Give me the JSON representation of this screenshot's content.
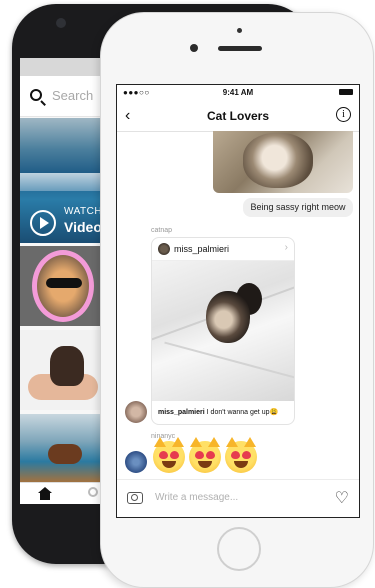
{
  "back_phone": {
    "search_placeholder": "Search",
    "video_tile": {
      "watch_label": "WATCH",
      "video_label": "Video"
    },
    "tabbar": {
      "home_icon": "home-icon",
      "search_icon": "search-icon"
    }
  },
  "front_phone": {
    "status_bar": {
      "signal": "●●●○○",
      "time": "9:41 AM"
    },
    "nav": {
      "back_glyph": "‹",
      "title": "Cat Lovers",
      "info_glyph": "i"
    },
    "messages": {
      "text_1": "Being sassy right meow",
      "shared_post": {
        "sender": "catnap",
        "username": "miss_palmieri",
        "caption_user": "miss_palmieri",
        "caption_text": "I don't wanna get up😩",
        "chevron": "›"
      },
      "emoji_sender": "ninanyc"
    },
    "composer": {
      "placeholder": "Write a message...",
      "heart_glyph": "♡"
    }
  }
}
